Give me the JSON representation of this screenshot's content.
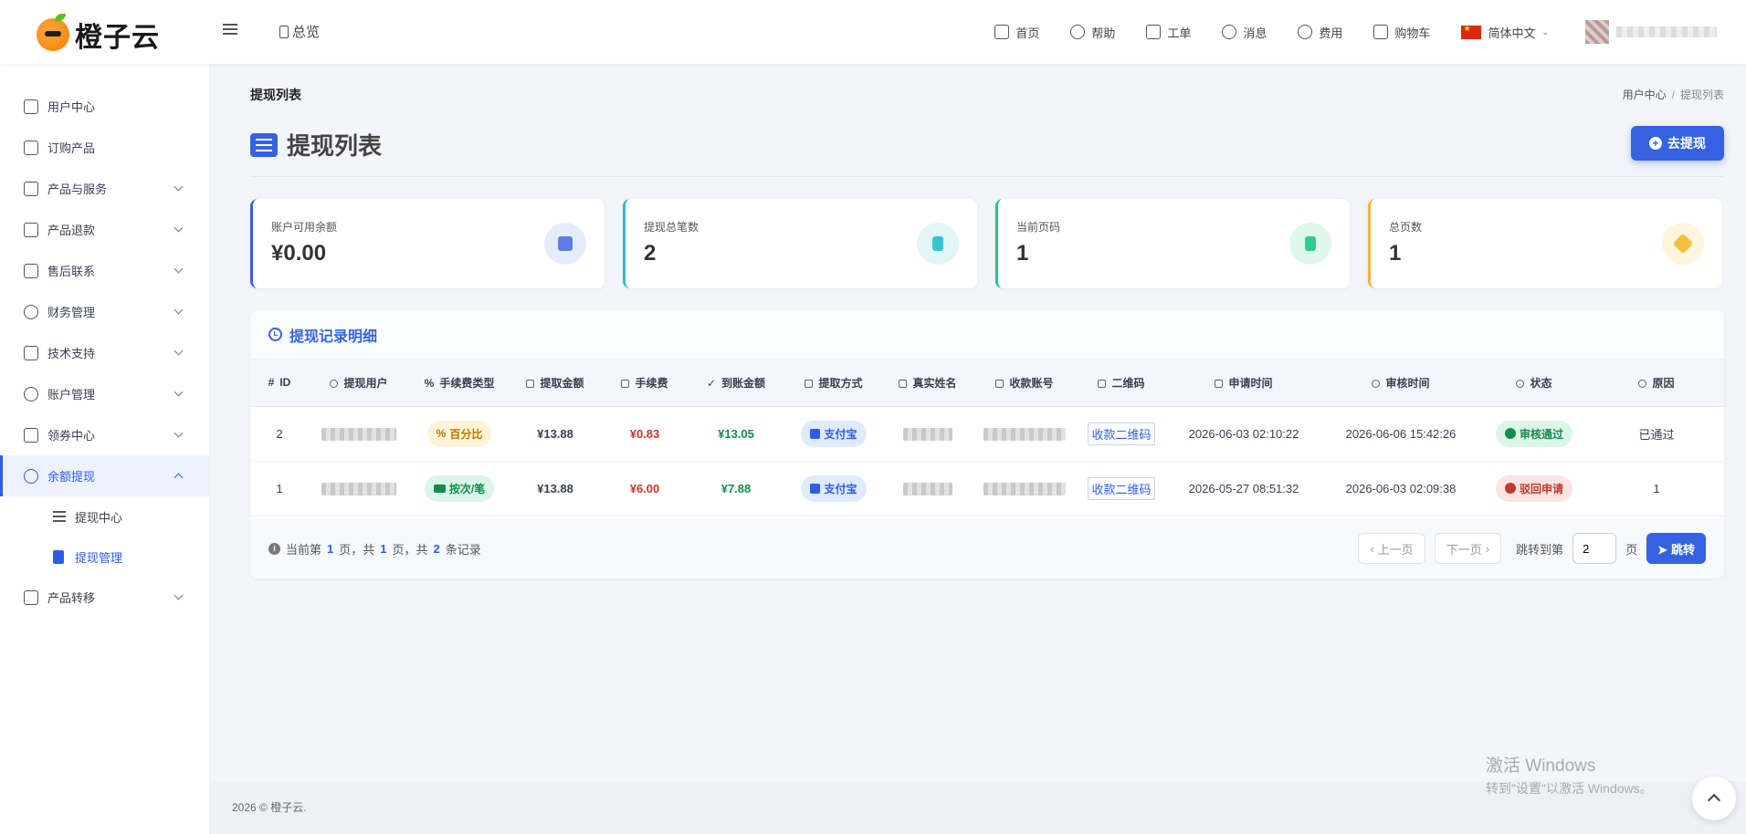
{
  "header": {
    "logo_text": "橙子云",
    "overview": "总览",
    "nav": [
      {
        "label": "首页",
        "icon": "monitor-icon"
      },
      {
        "label": "帮助",
        "icon": "help-icon"
      },
      {
        "label": "工单",
        "icon": "ticket-icon"
      },
      {
        "label": "消息",
        "icon": "bell-icon"
      },
      {
        "label": "费用",
        "icon": "dollar-icon"
      },
      {
        "label": "购物车",
        "icon": "cart-icon"
      }
    ],
    "language": "简体中文"
  },
  "sidebar": {
    "items": [
      {
        "label": "用户中心"
      },
      {
        "label": "订购产品"
      },
      {
        "label": "产品与服务"
      },
      {
        "label": "产品退款"
      },
      {
        "label": "售后联系"
      },
      {
        "label": "财务管理"
      },
      {
        "label": "技术支持"
      },
      {
        "label": "账户管理"
      },
      {
        "label": "领券中心"
      },
      {
        "label": "余额提现"
      },
      {
        "label": "产品转移"
      }
    ],
    "sub": [
      {
        "label": "提现中心"
      },
      {
        "label": "提现管理"
      }
    ]
  },
  "page": {
    "crumb_title": "提现列表",
    "breadcrumb_parent": "用户中心",
    "breadcrumb_current": "提现列表",
    "title": "提现列表",
    "withdraw_button": "去提现"
  },
  "stats": [
    {
      "label": "账户可用余额",
      "value": "¥0.00",
      "color": "#3562e0"
    },
    {
      "label": "提现总笔数",
      "value": "2",
      "color": "#2fb8c8"
    },
    {
      "label": "当前页码",
      "value": "1",
      "color": "#22c58b"
    },
    {
      "label": "总页数",
      "value": "1",
      "color": "#f5b335"
    }
  ],
  "table": {
    "heading": "提现记录明细",
    "columns": [
      "ID",
      "提现用户",
      "手续费类型",
      "提取金额",
      "手续费",
      "到账金额",
      "提取方式",
      "真实姓名",
      "收款账号",
      "二维码",
      "申请时间",
      "审核时间",
      "状态",
      "原因"
    ],
    "rows": [
      {
        "id": "2",
        "fee_type": "百分比",
        "amount": "¥13.88",
        "fee": "¥0.83",
        "received": "¥13.05",
        "method": "支付宝",
        "qrcode": "收款二维码",
        "applied": "2026-06-03 02:10:22",
        "reviewed": "2026-06-06 15:42:26",
        "status": "审核通过",
        "reason": "已通过"
      },
      {
        "id": "1",
        "fee_type": "按次/笔",
        "amount": "¥13.88",
        "fee": "¥6.00",
        "received": "¥7.88",
        "method": "支付宝",
        "qrcode": "收款二维码",
        "applied": "2026-05-27 08:51:32",
        "reviewed": "2026-06-03 02:09:38",
        "status": "驳回申请",
        "reason": "1"
      }
    ]
  },
  "pagination": {
    "info_prefix": "当前第",
    "current": "1",
    "info_mid1": "页，共",
    "total_pages": "1",
    "info_mid2": "页，共",
    "total_records": "2",
    "info_suffix": "条记录",
    "prev": "上一页",
    "next": "下一页",
    "jump_label": "跳转到第",
    "jump_value": "2",
    "page_unit": "页",
    "jump_button": "跳转"
  },
  "footer": {
    "text": "2026 © 橙子云."
  },
  "watermark": {
    "line1": "激活 Windows",
    "line2": "转到\"设置\"以激活 Windows。"
  }
}
